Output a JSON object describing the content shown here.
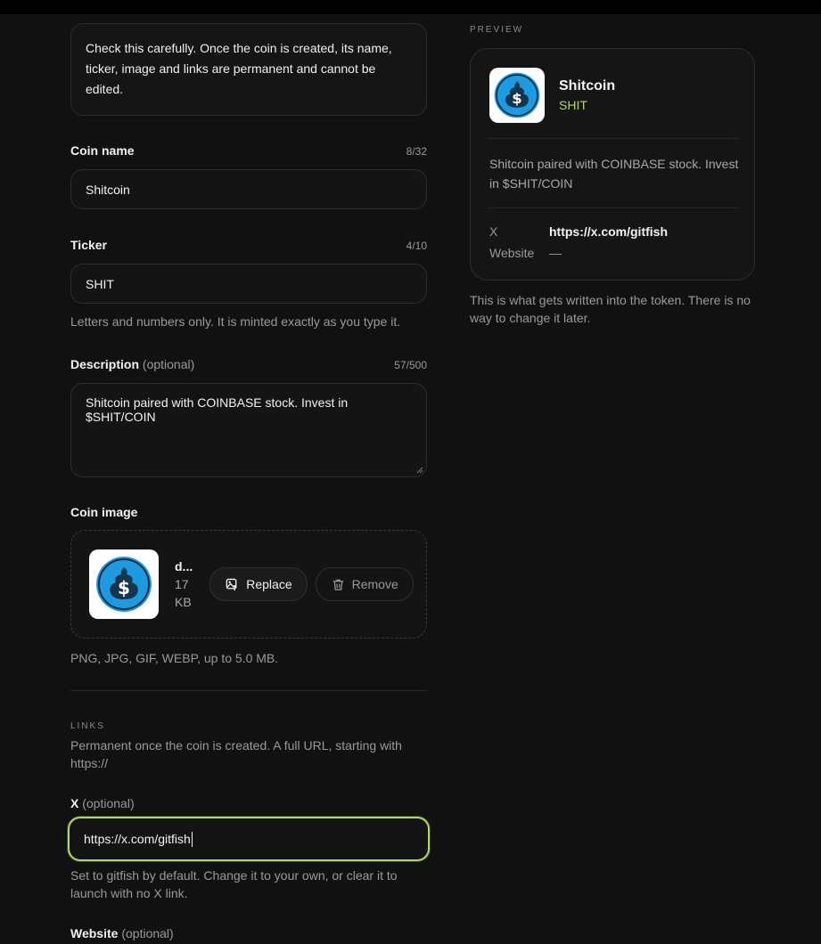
{
  "warning": "Check this carefully. Once the coin is created, its name, ticker, image and links are permanent and cannot be edited.",
  "coin_name": {
    "label": "Coin name",
    "counter": "8/32",
    "value": "Shitcoin"
  },
  "ticker": {
    "label": "Ticker",
    "counter": "4/10",
    "value": "SHIT",
    "help": "Letters and numbers only. It is minted exactly as you type it."
  },
  "description": {
    "label": "Description",
    "optional": "(optional)",
    "counter": "57/500",
    "value": "Shitcoin paired with COINBASE stock. Invest in $SHIT/COIN"
  },
  "coin_image": {
    "label": "Coin image",
    "file_name": "d...",
    "size_line1": "17",
    "size_line2": "KB",
    "replace_label": "Replace",
    "remove_label": "Remove",
    "help": "PNG, JPG, GIF, WEBP, up to 5.0 MB."
  },
  "links": {
    "section_label": "LINKS",
    "help": "Permanent once the coin is created. A full URL, starting with https://",
    "x": {
      "label": "X",
      "optional": "(optional)",
      "value": "https://x.com/gitfish",
      "help": "Set to gitfish by default. Change it to your own, or clear it to launch with no X link."
    },
    "website": {
      "label": "Website",
      "optional": "(optional)"
    }
  },
  "preview": {
    "section_label": "PREVIEW",
    "name": "Shitcoin",
    "ticker": "SHIT",
    "description": "Shitcoin paired with COINBASE stock. Invest in $SHIT/COIN",
    "x_key": "X",
    "x_value": "https://x.com/gitfish",
    "website_key": "Website",
    "website_value": "—",
    "note": "This is what gets written into the token. There is no way to change it later."
  },
  "colors": {
    "accent": "#b5d66a",
    "background": "#111111",
    "logo_blue": "#1e9be0"
  },
  "icons": {
    "coin_logo": "bitcoin-dollar-pile-icon",
    "replace": "image-replace-icon",
    "remove": "trash-icon"
  }
}
